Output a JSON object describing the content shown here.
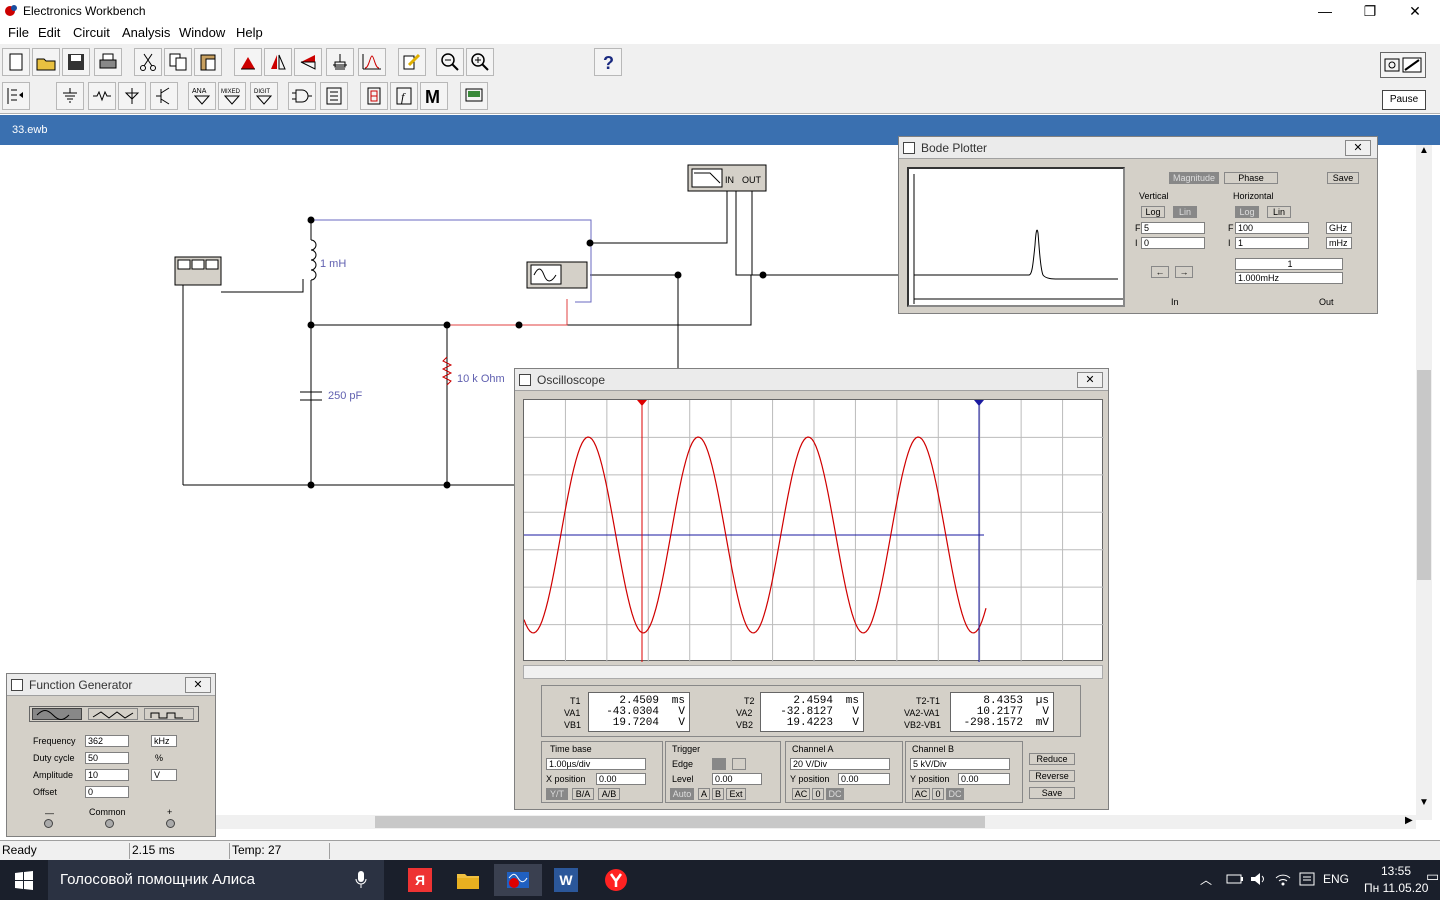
{
  "window": {
    "title": "Electronics Workbench",
    "btn_min": "—",
    "btn_max": "❐",
    "btn_close": "✕"
  },
  "menu": [
    "File",
    "Edit",
    "Circuit",
    "Analysis",
    "Window",
    "Help"
  ],
  "toolbar": {
    "pause_label": "Pause"
  },
  "document": {
    "title": "33.ewb"
  },
  "circuit": {
    "inductor": "1 mH",
    "capacitor": "250 pF",
    "resistor": "10 k Ohm",
    "bode_in": "IN",
    "bode_out": "OUT"
  },
  "bode": {
    "title": "Bode Plotter",
    "magnitude": "Magnitude",
    "phase": "Phase",
    "save": "Save",
    "vertical": "Vertical",
    "horizontal": "Horizontal",
    "log": "Log",
    "lin": "Lin",
    "v_f": "5",
    "v_i": "0",
    "h_f": "100",
    "h_i": "1",
    "h_f_unit": "GHz",
    "h_i_unit": "mHz",
    "f_label": "F",
    "i_label": "I",
    "readout_1": "1",
    "readout_2": "1.000mHz",
    "in_label": "In",
    "out_label": "Out"
  },
  "osc": {
    "title": "Oscilloscope",
    "t1_label": "T1",
    "va1_label": "VA1",
    "vb1_label": "VB1",
    "t1": "2.4509",
    "t1_u": "ms",
    "va1": "-43.0304",
    "va1_u": "V",
    "vb1": "19.7204",
    "vb1_u": "V",
    "t2_label": "T2",
    "va2_label": "VA2",
    "vb2_label": "VB2",
    "t2": "2.4594",
    "t2_u": "ms",
    "va2": "-32.8127",
    "va2_u": "V",
    "vb2": "19.4223",
    "vb2_u": "V",
    "dt_label": "T2-T1",
    "dva_label": "VA2-VA1",
    "dvb_label": "VB2-VB1",
    "dt": "8.4353",
    "dt_u": "µs",
    "dva": "10.2177",
    "dva_u": "V",
    "dvb": "-298.1572",
    "dvb_u": "mV",
    "timebase": "Time base",
    "timebase_val": "1.00µs/div",
    "xpos_label": "X position",
    "xpos": "0.00",
    "yt": "Y/T",
    "ba": "B/A",
    "ab": "A/B",
    "trigger": "Trigger",
    "edge": "Edge",
    "level": "Level",
    "level_val": "0.00",
    "auto": "Auto",
    "a": "A",
    "b": "B",
    "ext": "Ext",
    "cha": "Channel A",
    "cha_val": "20  V/Div",
    "cha_ypos_label": "Y position",
    "cha_ypos": "0.00",
    "chb": "Channel B",
    "chb_val": "5 kV/Div",
    "chb_ypos_label": "Y position",
    "chb_ypos": "0.00",
    "ac": "AC",
    "zero": "0",
    "dc": "DC",
    "reduce": "Reduce",
    "reverse": "Reverse",
    "save": "Save"
  },
  "fg": {
    "title": "Function Generator",
    "freq_label": "Frequency",
    "freq": "362",
    "freq_unit": "kHz",
    "duty_label": "Duty cycle",
    "duty": "50",
    "duty_unit": "%",
    "amp_label": "Amplitude",
    "amp": "10",
    "amp_unit": "V",
    "offset_label": "Offset",
    "offset": "0",
    "minus": "—",
    "common": "Common",
    "plus": "+"
  },
  "status": {
    "state": "Ready",
    "time": "2.15 ms",
    "temp": "Temp:  27"
  },
  "taskbar": {
    "search": "Голосовой помощник Алиса",
    "lang": "ENG",
    "time": "13:55",
    "date": "Пн 11.05.20"
  }
}
